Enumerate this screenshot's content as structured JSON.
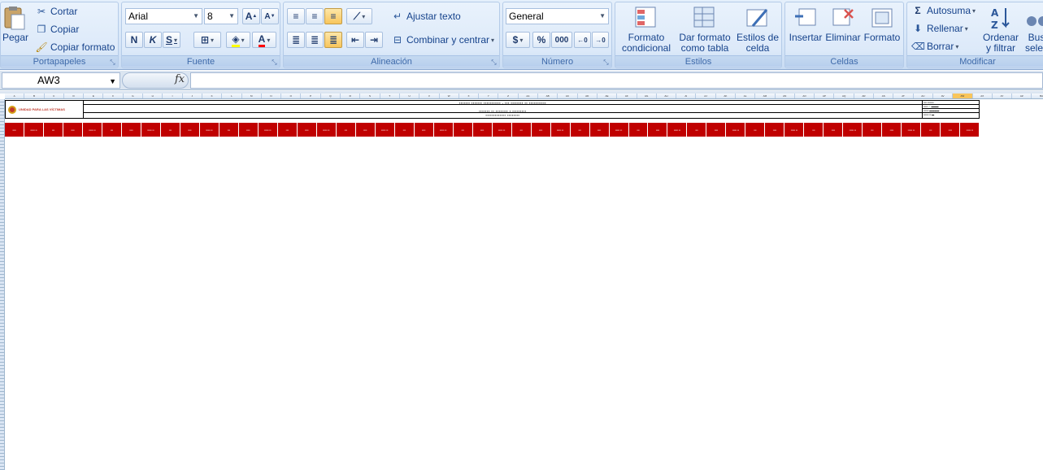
{
  "ribbon": {
    "clipboard": {
      "label": "Portapapeles",
      "paste": "Pegar",
      "cut": "Cortar",
      "copy": "Copiar",
      "format_painter": "Copiar formato"
    },
    "font": {
      "label": "Fuente",
      "font_name": "Arial",
      "font_size": "8",
      "bold": "N",
      "italic": "K",
      "underline": "S",
      "grow": "A",
      "shrink": "A",
      "font_color_letter": "A"
    },
    "alignment": {
      "label": "Alineación",
      "wrap": "Ajustar texto",
      "merge": "Combinar y centrar"
    },
    "number": {
      "label": "Número",
      "format": "General",
      "currency": "$",
      "percent": "%",
      "thousands": "000"
    },
    "styles": {
      "label": "Estilos",
      "conditional": "Formato condicional",
      "as_table": "Dar formato como tabla",
      "cell_styles": "Estilos de celda"
    },
    "cells": {
      "label": "Celdas",
      "insert": "Insertar",
      "delete": "Eliminar",
      "format": "Formato"
    },
    "editing": {
      "label": "Modificar",
      "autosum": "Autosuma",
      "fill": "Rellenar",
      "clear": "Borrar",
      "sort": "Ordenar y filtrar",
      "find": "Bus selec"
    }
  },
  "formula_bar": {
    "name_box": "AW3",
    "fx": "fx",
    "formula": ""
  },
  "sheet": {
    "logo_text": "UNIDAD PARA LAS VÍCTIMAS",
    "selected_column": "AW",
    "columns": [
      "A",
      "B",
      "C",
      "D",
      "E",
      "F",
      "G",
      "H",
      "I",
      "J",
      "K",
      "L",
      "M",
      "N",
      "O",
      "P",
      "Q",
      "R",
      "S",
      "T",
      "U",
      "V",
      "W",
      "X",
      "Y",
      "Z",
      "AA",
      "AB",
      "AC",
      "AD",
      "AE",
      "AF",
      "AG",
      "AH",
      "AI",
      "AJ",
      "AK",
      "AL",
      "AM",
      "AN",
      "AO",
      "AP",
      "AQ",
      "AR",
      "AS",
      "AT",
      "AU",
      "AV",
      "AW",
      "AX",
      "AY",
      "AZ",
      "BA"
    ]
  },
  "colors": {
    "accent": "#c00000",
    "ribbon": "#dbe5f1",
    "selected": "#f8c55c"
  }
}
